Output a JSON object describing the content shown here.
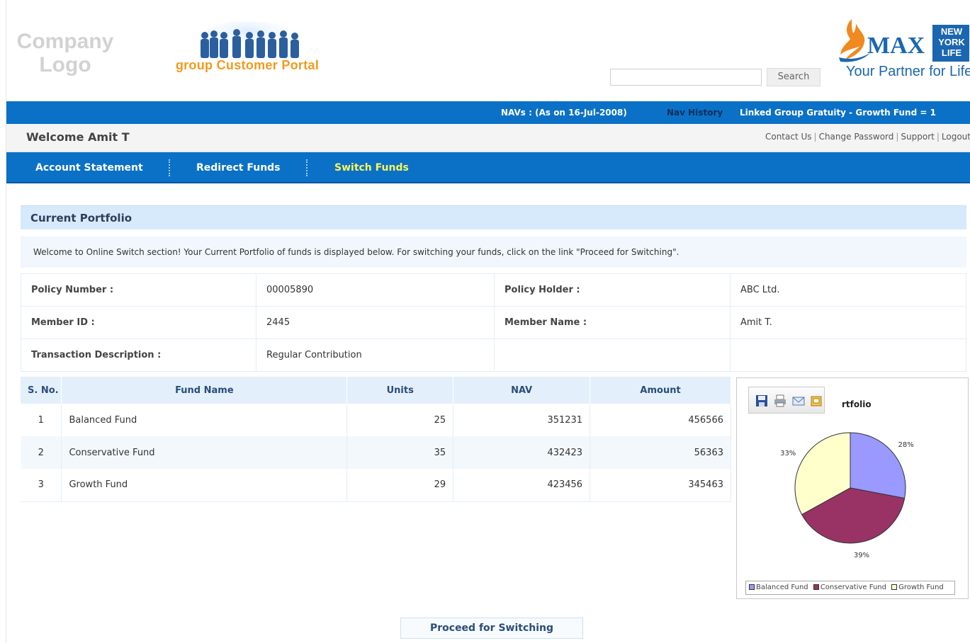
{
  "header": {
    "company_logo_line1": "Company",
    "company_logo_line2": "Logo",
    "portal_title": "group Customer Portal",
    "search_placeholder": "",
    "search_button": "Search",
    "brand_name": "MAX",
    "brand_badge": "NEW YORK LIFE",
    "tagline": "Your Partner for Life"
  },
  "infobar": {
    "nav_date": "NAVs : (As on 16-Jul-2008)",
    "nav_history": "Nav History",
    "fund_name": "Linked Group Gratuity - Growth Fund  = 1"
  },
  "welcome": {
    "greeting": "Welcome Amit T",
    "links": [
      "Contact Us",
      "Change Password",
      "Support",
      "Logout"
    ]
  },
  "nav": {
    "tabs": [
      "Account Statement",
      "Redirect Funds",
      "Switch Funds"
    ],
    "active": "Switch Funds"
  },
  "portfolio": {
    "section_title": "Current Portfolio",
    "intro": "Welcome to Online Switch section! Your Current Portfolio of funds is displayed below. For switching your funds, click on the link \"Proceed for Switching\".",
    "policy_number_label": "Policy Number :",
    "policy_number": "00005890",
    "policy_holder_label": "Policy Holder :",
    "policy_holder": "ABC Ltd.",
    "member_id_label": "Member ID :",
    "member_id": "2445",
    "member_name_label": "Member Name :",
    "member_name": "Amit T.",
    "txn_desc_label": "Transaction Description :",
    "txn_desc": "Regular Contribution"
  },
  "funds": {
    "headers": [
      "S. No.",
      "Fund Name",
      "Units",
      "NAV",
      "Amount"
    ],
    "rows": [
      [
        "1",
        "Balanced Fund",
        "25",
        "351231",
        "456566"
      ],
      [
        "2",
        "Conservative Fund",
        "35",
        "432423",
        "56363"
      ],
      [
        "3",
        "Growth Fund",
        "29",
        "423456",
        "345463"
      ]
    ]
  },
  "chart_data": {
    "type": "pie",
    "title": "rtfolio",
    "categories": [
      "Balanced Fund",
      "Conservative Fund",
      "Growth Fund"
    ],
    "values": [
      28,
      39,
      33
    ],
    "labels": [
      "28%",
      "39%",
      "33%"
    ],
    "colors": [
      "#9999ff",
      "#993366",
      "#ffffcc"
    ],
    "legend_position": "bottom"
  },
  "chart_toolbar_icons": [
    "save-icon",
    "print-icon",
    "email-icon",
    "export-icon"
  ],
  "proceed_button": "Proceed for Switching",
  "colors": {
    "nav_blue": "#0a71c6",
    "active_tab": "#fff45a",
    "section_head": "#d6eafb"
  }
}
